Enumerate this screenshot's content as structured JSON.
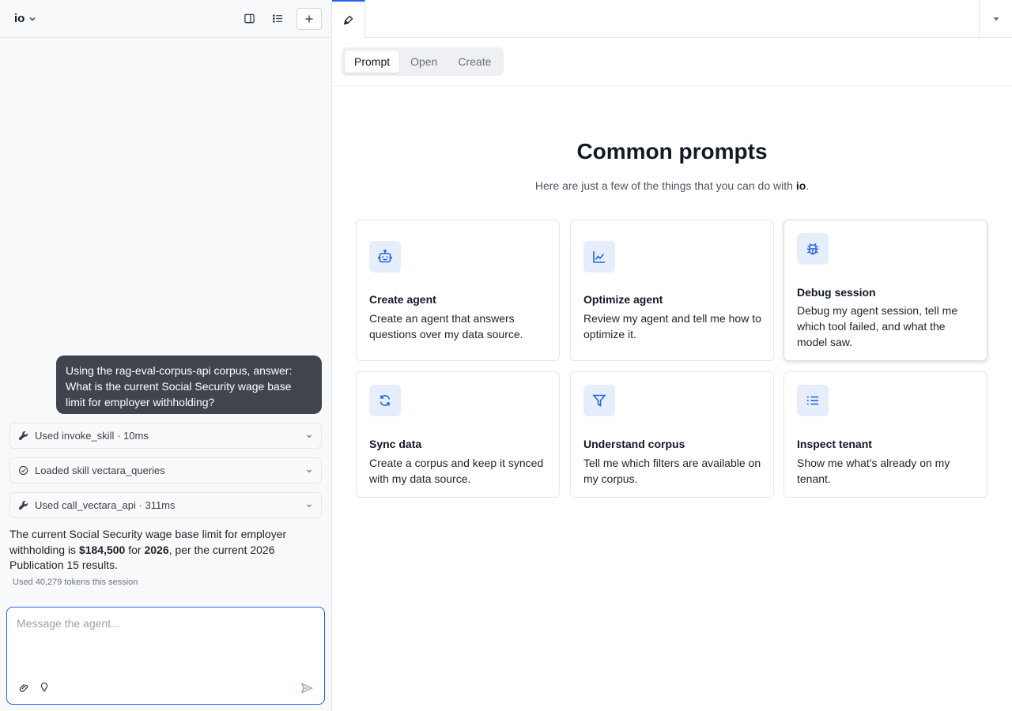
{
  "app": {
    "brand": "io"
  },
  "chat": {
    "user_message": "Using the rag-eval-corpus-api corpus, answer: What is the current Social Security wage base limit for employer withholding?",
    "tool_calls": [
      {
        "label": "Used invoke_skill · 10ms",
        "icon": "wrench-icon"
      },
      {
        "label": "Loaded skill vectara_queries",
        "icon": "skill-icon"
      },
      {
        "label": "Used call_vectara_api · 311ms",
        "icon": "wrench-icon"
      }
    ],
    "answer": {
      "part1": "The current Social Security wage base limit for employer withholding is ",
      "amount": "$184,500",
      "part2": " for ",
      "year": "2026",
      "part3": ", per the current 2026 Publication 15 results."
    },
    "tokens_note": "Used 40,279 tokens this session",
    "composer_placeholder": "Message the agent..."
  },
  "modes": {
    "tabs": [
      "Prompt",
      "Open",
      "Create"
    ],
    "active": "Prompt"
  },
  "prompts": {
    "heading": "Common prompts",
    "sub_prefix": "Here are just a few of the things that you can do with ",
    "sub_brand": "io",
    "sub_suffix": ".",
    "cards": [
      {
        "title": "Create agent",
        "desc": "Create an agent that answers questions over my data source.",
        "icon": "robot-icon"
      },
      {
        "title": "Optimize agent",
        "desc": "Review my agent and tell me how to optimize it.",
        "icon": "chart-icon"
      },
      {
        "title": "Debug session",
        "desc": "Debug my agent session, tell me which tool failed, and what the model saw.",
        "icon": "bug-icon"
      },
      {
        "title": "Sync data",
        "desc": "Create a corpus and keep it synced with my data source.",
        "icon": "sync-icon"
      },
      {
        "title": "Understand corpus",
        "desc": "Tell me which filters are available on my corpus.",
        "icon": "filter-icon"
      },
      {
        "title": "Inspect tenant",
        "desc": "Show me what's already on my tenant.",
        "icon": "list-icon"
      }
    ]
  },
  "colors": {
    "accent": "#2563eb",
    "user_bubble": "#3f444d",
    "icon_tile": "#e6eefc"
  }
}
